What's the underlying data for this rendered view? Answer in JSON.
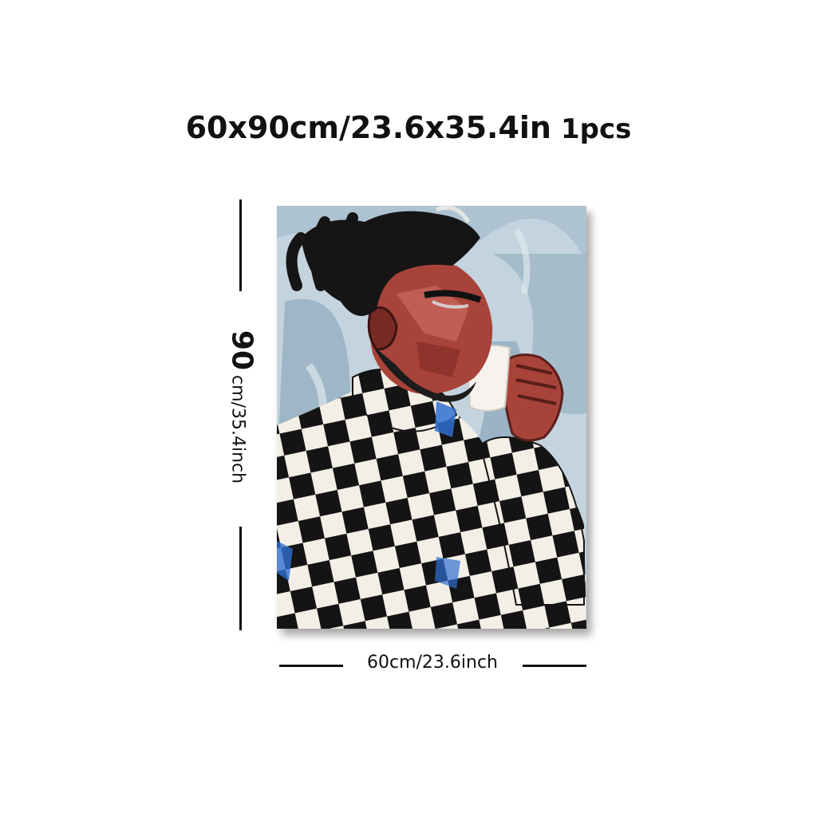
{
  "header": {
    "size_text": "60x90cm/23.6x35.4in",
    "qty_text": "1pcs"
  },
  "dimensions": {
    "height_value": "90",
    "height_unit_text": "cm/35.4inch",
    "width_text": "60cm/23.6inch"
  },
  "artwork": {
    "subject": "portrait-man-checkered-sweater-drinking",
    "colors": {
      "background": "#b9ccd9",
      "sky_dark": "#7f9fb6",
      "skin": "#a8433a",
      "skin_dark": "#5a1e1a",
      "hair": "#151515",
      "check_black": "#141414",
      "check_white": "#f3efe6",
      "accent_blue": "#2f6fd0",
      "cup": "#f6f3ee"
    }
  }
}
